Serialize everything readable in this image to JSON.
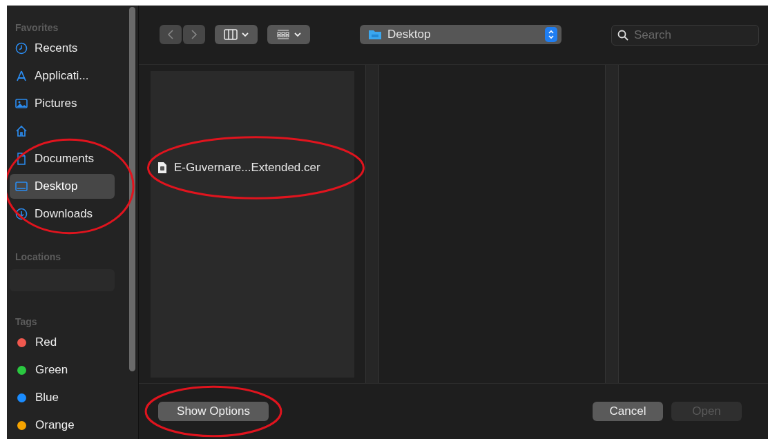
{
  "sidebar": {
    "sections": [
      {
        "title": "Favorites",
        "items": [
          {
            "kind": "recents",
            "label": "Recents",
            "selected": false
          },
          {
            "kind": "applications",
            "label": "Applicati...",
            "selected": false
          },
          {
            "kind": "pictures",
            "label": "Pictures",
            "selected": false
          },
          {
            "kind": "home",
            "selected": false
          },
          {
            "kind": "documents",
            "label": "Documents",
            "selected": false,
            "circled": true
          },
          {
            "kind": "desktop",
            "label": "Desktop",
            "selected": true,
            "circled": true
          },
          {
            "kind": "downloads",
            "label": "Downloads",
            "selected": false,
            "circled": true
          }
        ]
      },
      {
        "title": "Locations",
        "items": [
          {
            "kind": "blank"
          }
        ]
      },
      {
        "title": "Tags",
        "items": [
          {
            "kind": "tag",
            "label": "Red",
            "color": "#f0584e",
            "selected": false
          },
          {
            "kind": "tag",
            "label": "Green",
            "color": "#2ac840",
            "selected": false
          },
          {
            "kind": "tag",
            "label": "Blue",
            "color": "#1a8cff",
            "selected": false
          },
          {
            "kind": "tag",
            "label": "Orange",
            "color": "#f5a300",
            "selected": false
          }
        ]
      }
    ]
  },
  "toolbar": {
    "location": {
      "label": "Desktop"
    },
    "search": {
      "placeholder": "Search"
    }
  },
  "browser": {
    "columns": [
      {
        "kind": "files",
        "files": [
          {
            "name": "E-Guvernare...Extended.cer",
            "selected": false,
            "circled": true
          }
        ]
      },
      {
        "kind": "empty"
      },
      {
        "kind": "empty"
      }
    ]
  },
  "footer": {
    "buttons": [
      {
        "kind": "options",
        "label": "Show Options",
        "disabled": false,
        "circled": true
      },
      {
        "kind": "cancel",
        "label": "Cancel",
        "disabled": false
      },
      {
        "kind": "open",
        "label": "Open",
        "disabled": true
      }
    ]
  }
}
